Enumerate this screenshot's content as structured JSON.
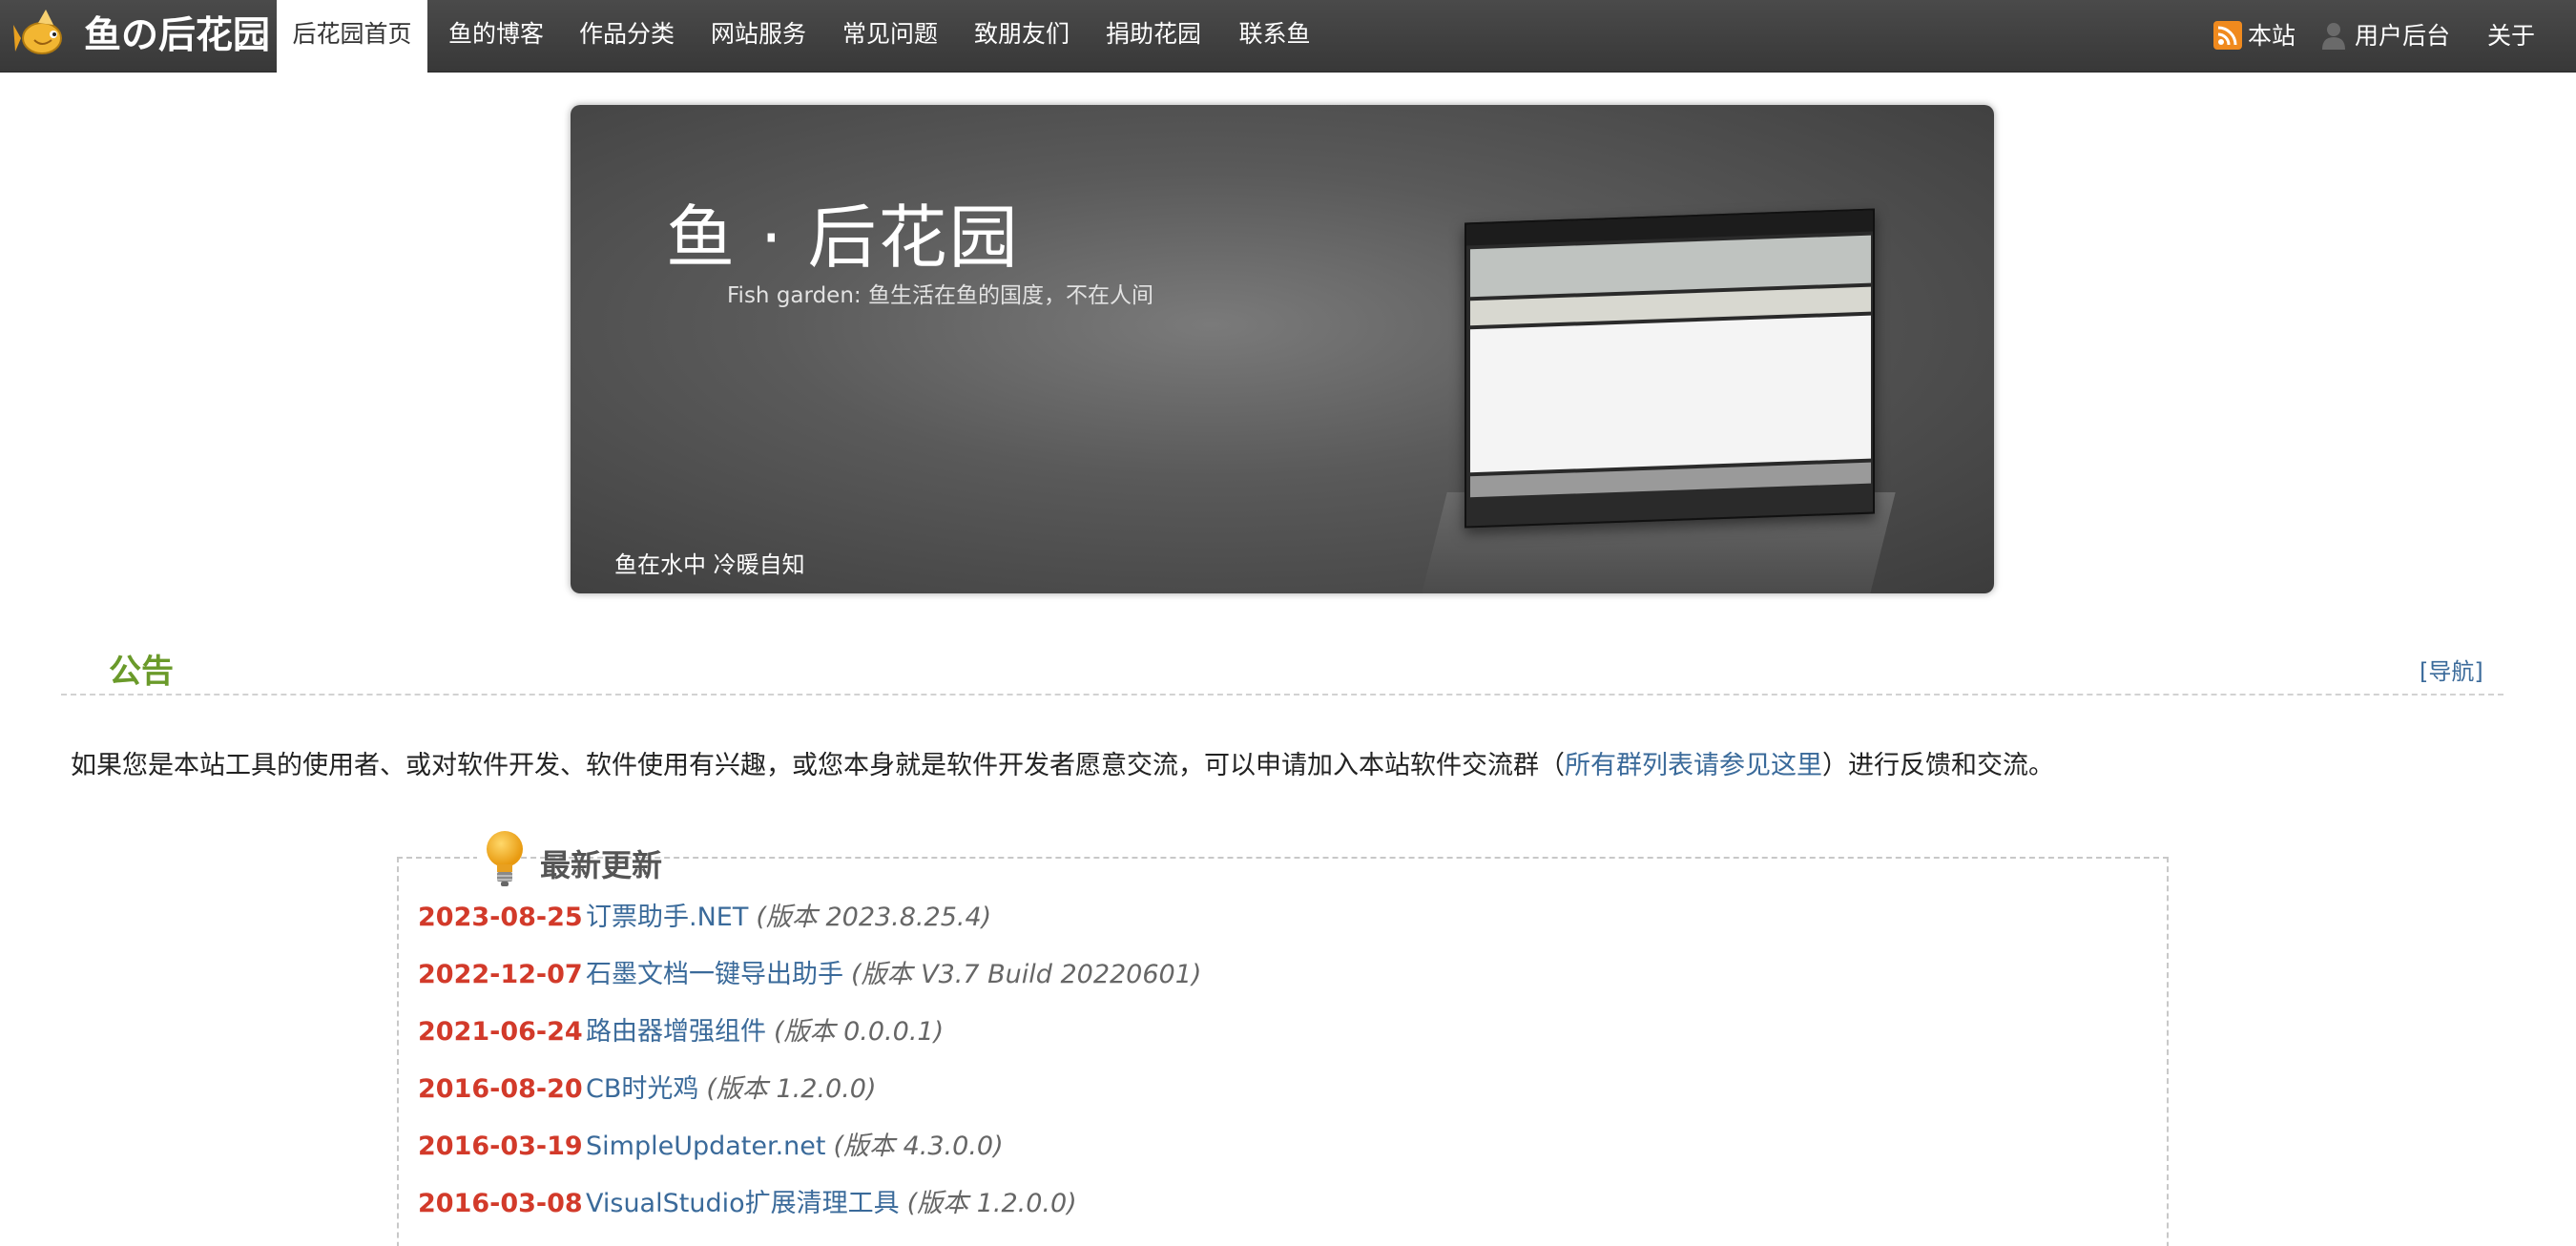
{
  "brand": {
    "title": "鱼の后花园",
    "logo_icon": "fish-icon"
  },
  "nav": {
    "items": [
      {
        "label": "后花园首页",
        "active": true
      },
      {
        "label": "鱼的博客"
      },
      {
        "label": "作品分类"
      },
      {
        "label": "网站服务"
      },
      {
        "label": "常见问题"
      },
      {
        "label": "致朋友们"
      },
      {
        "label": "捐助花园"
      },
      {
        "label": "联系鱼"
      }
    ],
    "right": {
      "rss_label": "本站",
      "rss_icon": "rss-icon",
      "user_label": "用户后台",
      "user_icon": "user-icon",
      "about_label": "关于"
    }
  },
  "banner": {
    "title": "鱼 · 后花园",
    "subtitle": "Fish garden: 鱼生活在鱼的国度，不在人间",
    "caption": "鱼在水中 冷暖自知"
  },
  "announcement": {
    "title": "公告",
    "nav_link": "[导航]",
    "text_before": "如果您是本站工具的使用者、或对软件开发、软件使用有兴趣，或您本身就是软件开发者愿意交流，可以申请加入本站软件交流群（",
    "link_text": "所有群列表请参见这里",
    "text_after": "）进行反馈和交流。"
  },
  "updates": {
    "title": "最新更新",
    "icon": "lightbulb-icon",
    "items": [
      {
        "date": "2023-08-25",
        "name": "订票助手.NET",
        "version": "(版本 2023.8.25.4)"
      },
      {
        "date": "2022-12-07",
        "name": "石墨文档一键导出助手",
        "version": "(版本 V3.7 Build 20220601)"
      },
      {
        "date": "2021-06-24",
        "name": "路由器增强组件",
        "version": "(版本 0.0.0.1)"
      },
      {
        "date": "2016-08-20",
        "name": "CB时光鸡",
        "version": "(版本 1.2.0.0)"
      },
      {
        "date": "2016-03-19",
        "name": "SimpleUpdater.net",
        "version": "(版本 4.3.0.0)"
      },
      {
        "date": "2016-03-08",
        "name": "VisualStudio扩展清理工具",
        "version": "(版本 1.2.0.0)"
      }
    ]
  },
  "colors": {
    "topbar": "#404040",
    "accent_green": "#6a9a2a",
    "date_red": "#d23a2a",
    "link_blue": "#3a6a9a"
  }
}
